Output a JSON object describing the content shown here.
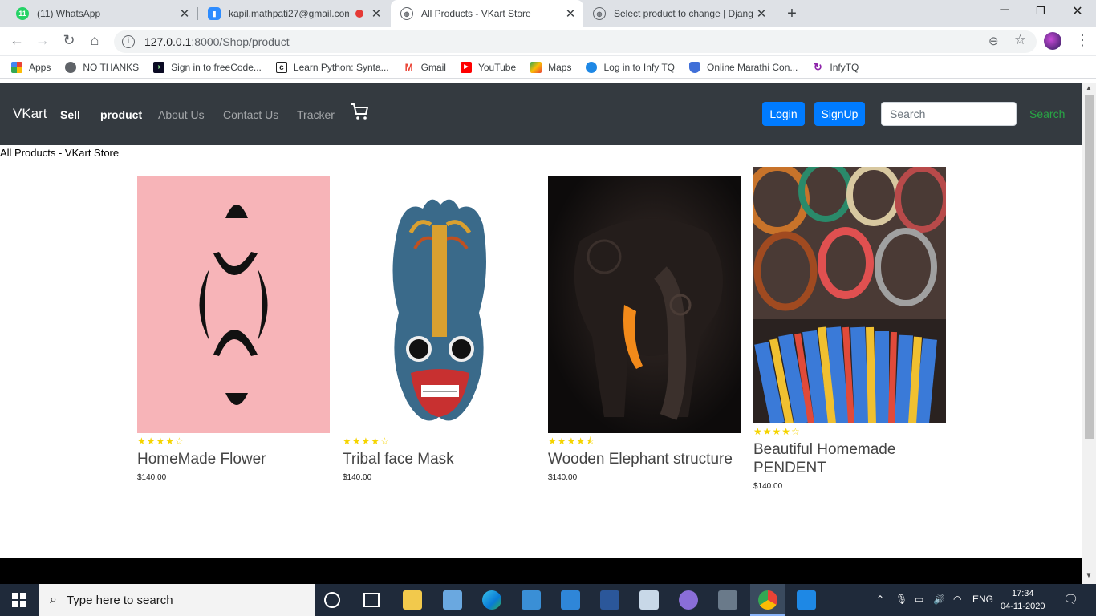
{
  "browser": {
    "tabs": [
      {
        "title": "(11) WhatsApp",
        "icon": "whatsapp-icon",
        "favicon_text": "11",
        "color": "#25d366"
      },
      {
        "title": "kapil.mathpati27@gmail.com",
        "icon": "zoom-icon",
        "favicon_text": "",
        "color": "#2d8cff"
      },
      {
        "title": "All Products - VKart Store",
        "icon": "globe-icon",
        "favicon_text": "",
        "color": "#5f6368",
        "active": true
      },
      {
        "title": "Select product to change | Djang",
        "icon": "globe-icon",
        "favicon_text": "",
        "color": "#5f6368"
      }
    ],
    "url_host": "127.0.0.1",
    "url_path": ":8000/Shop/product",
    "bookmarks": [
      {
        "label": "Apps",
        "icon": "apps-grid-icon"
      },
      {
        "label": "NO THANKS",
        "icon": "globe-icon"
      },
      {
        "label": "Sign in to freeCode...",
        "icon": "freecodecamp-icon"
      },
      {
        "label": "Learn Python: Synta...",
        "icon": "codecademy-icon"
      },
      {
        "label": "Gmail",
        "icon": "gmail-icon"
      },
      {
        "label": "YouTube",
        "icon": "youtube-icon"
      },
      {
        "label": "Maps",
        "icon": "maps-icon"
      },
      {
        "label": "Log in to Infy TQ",
        "icon": "infytq-globe-icon"
      },
      {
        "label": "Online Marathi Con...",
        "icon": "shield-icon"
      },
      {
        "label": "InfyTQ",
        "icon": "infytq-icon"
      }
    ]
  },
  "site": {
    "brand": "VKart",
    "nav": [
      {
        "label": "Sell",
        "active": true
      },
      {
        "label": "product",
        "active": true
      },
      {
        "label": "About Us",
        "active": false
      },
      {
        "label": "Contact Us",
        "active": false
      },
      {
        "label": "Tracker",
        "active": false
      }
    ],
    "login_label": "Login",
    "signup_label": "SignUp",
    "search_placeholder": "Search",
    "search_button": "Search",
    "page_title": "All Products - VKart Store",
    "products": [
      {
        "name": "HomeMade Flower",
        "price": "$140.00",
        "rating": 4,
        "stars": "★★★★☆",
        "image": "pink-flower-ornament"
      },
      {
        "name": "Tribal face Mask",
        "price": "$140.00",
        "rating": 4,
        "stars": "★★★★☆",
        "image": "tribal-mask"
      },
      {
        "name": "Wooden Elephant structure",
        "price": "$140.00",
        "rating": 4.5,
        "stars": "★★★★⯪",
        "image": "wooden-elephant"
      },
      {
        "name": "Beautiful Homemade PENDENT",
        "price": "$140.00",
        "rating": 4,
        "stars": "★★★★☆",
        "image": "bangles"
      }
    ]
  },
  "taskbar": {
    "search_placeholder": "Type here to search",
    "language": "ENG",
    "time": "17:34",
    "date": "04-11-2020"
  }
}
